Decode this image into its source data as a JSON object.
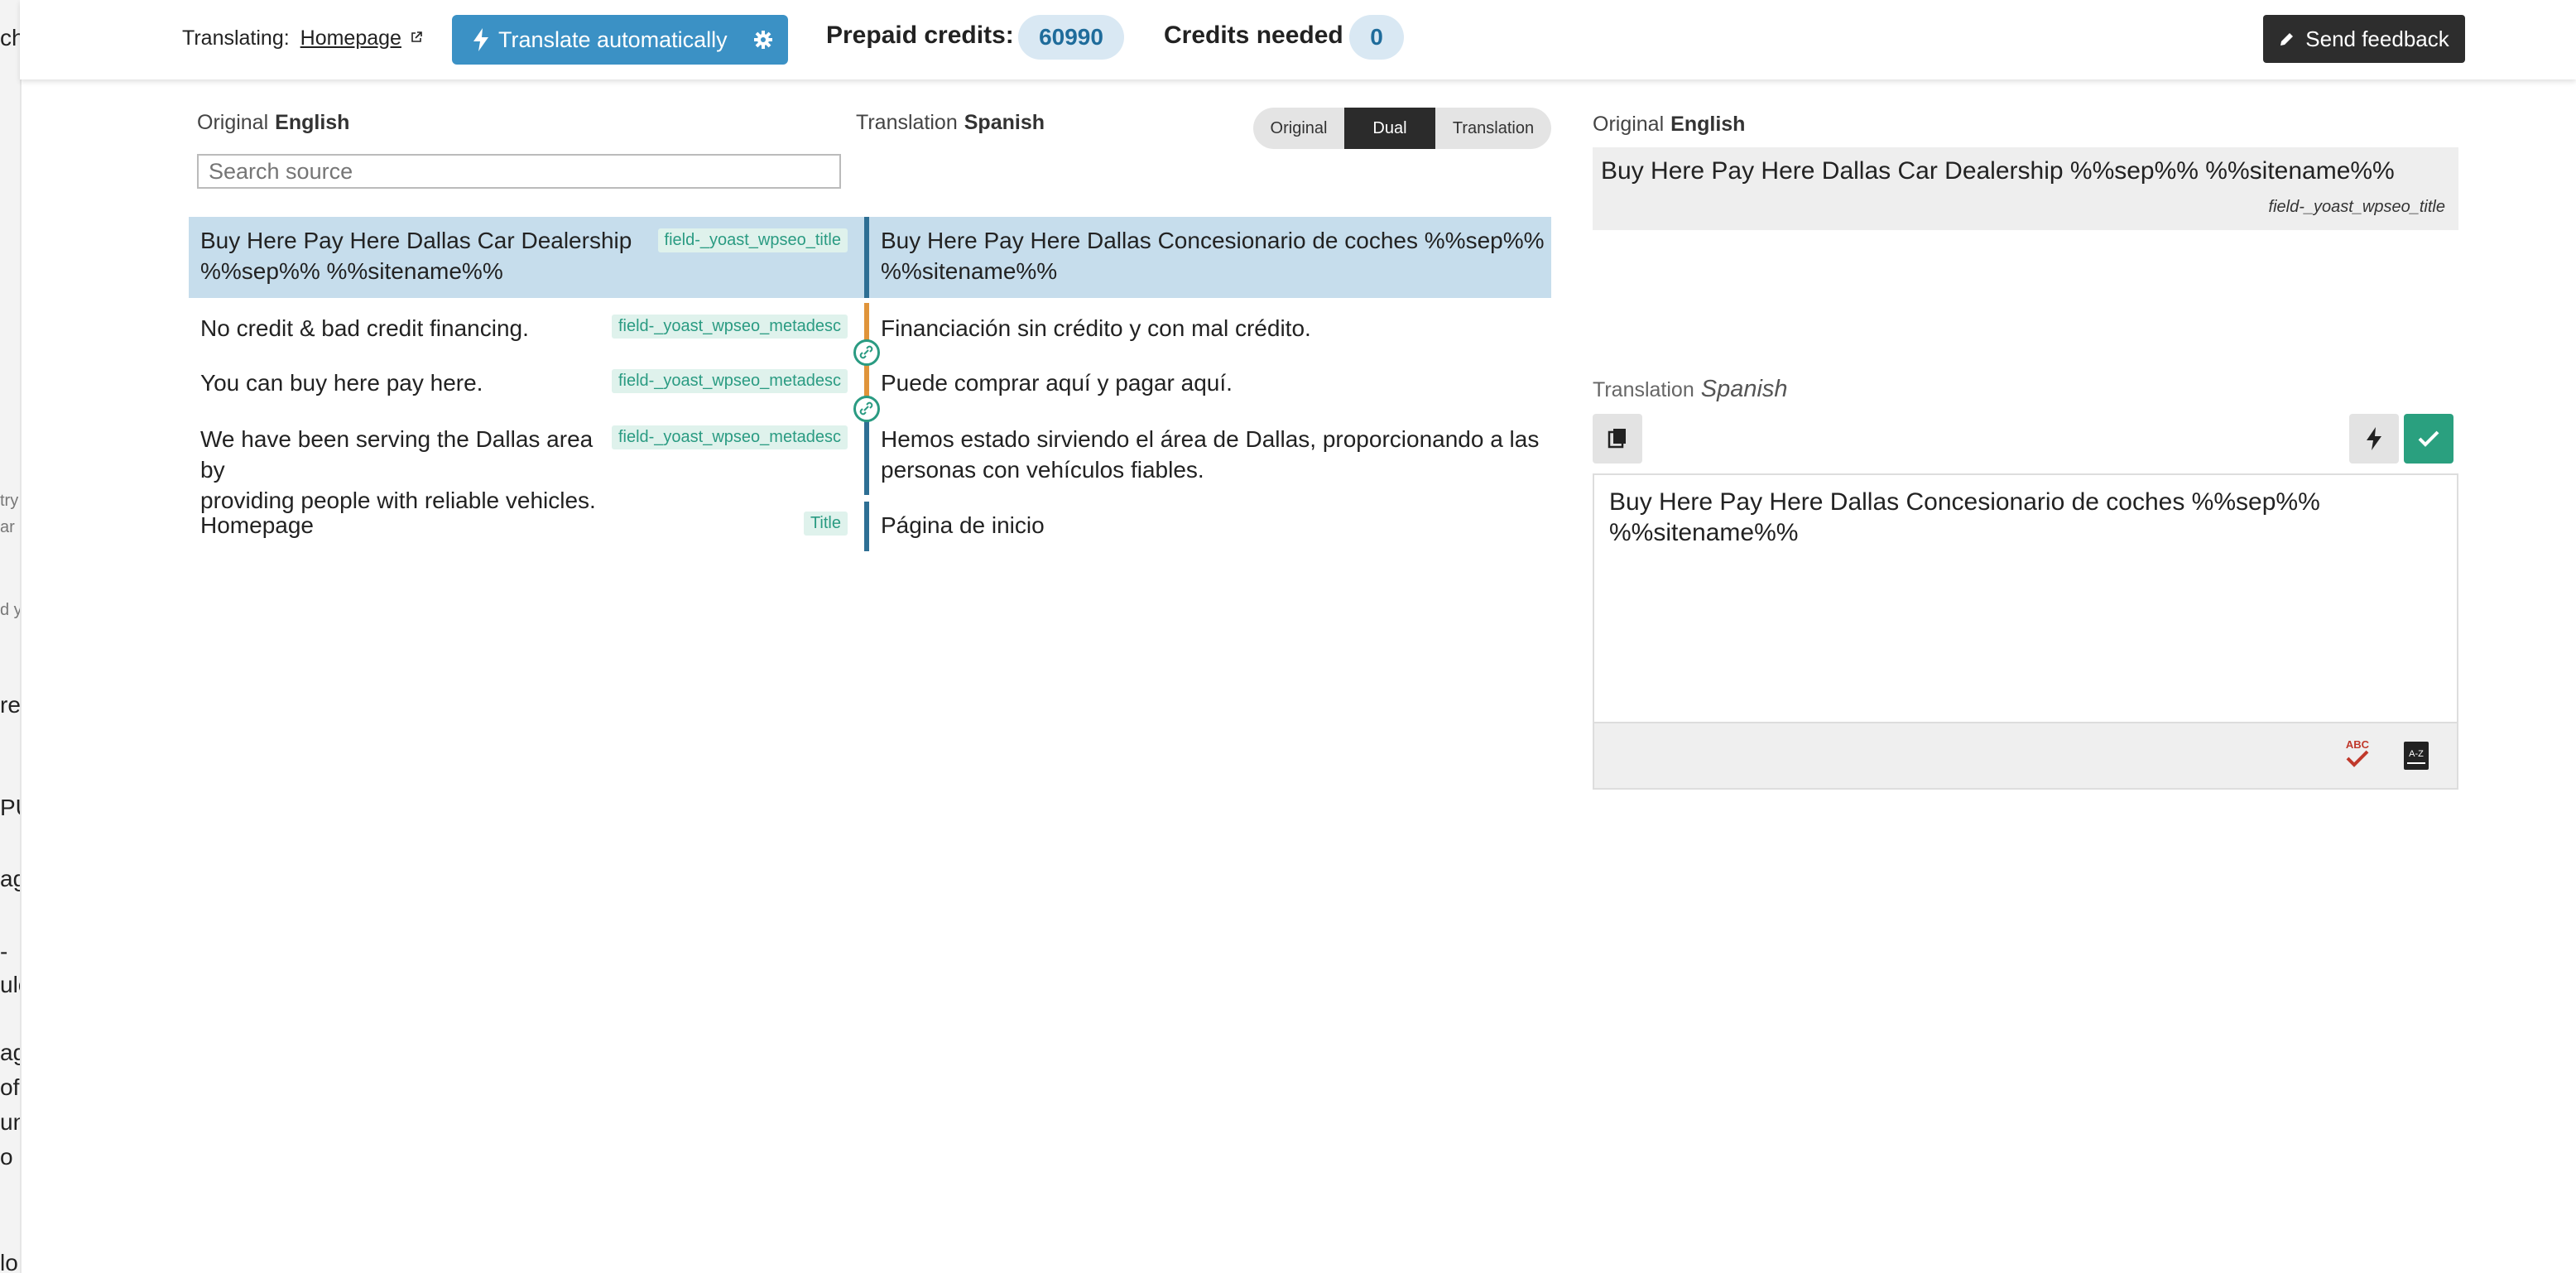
{
  "background": {
    "fragments": [
      "cha",
      "try",
      "ar",
      "d y",
      "re",
      "PU",
      "ag",
      "-",
      "ulo",
      "ag",
      "of",
      "un",
      "o",
      "lo"
    ]
  },
  "topbar": {
    "translating_label": "Translating:",
    "page_link": "Homepage",
    "translate_auto_label": "Translate automatically",
    "prepaid_label": "Prepaid credits:",
    "prepaid_value": "60990",
    "needed_label": "Credits needed",
    "needed_value": "0",
    "feedback_label": "Send feedback"
  },
  "left_column": {
    "label": "Original",
    "language": "English",
    "search_placeholder": "Search source"
  },
  "middle_column": {
    "label": "Translation",
    "language": "Spanish"
  },
  "view_toggle": {
    "options": [
      "Original",
      "Dual",
      "Translation"
    ],
    "selected": "Dual"
  },
  "rows": [
    {
      "source_line1": "Buy Here Pay Here Dallas Car Dealership",
      "source_line2": "%%sep%% %%sitename%%",
      "tag": "field-_yoast_wpseo_title",
      "translation_line1": "Buy Here Pay Here Dallas Concesionario de coches %%sep%%",
      "translation_line2": "%%sitename%%",
      "selected": true
    },
    {
      "source_line1": "No credit & bad credit financing.",
      "tag": "field-_yoast_wpseo_metadesc",
      "translation_line1": "Financiación sin crédito y con mal crédito.",
      "linked": true
    },
    {
      "source_line1": "You can buy here pay here.",
      "tag": "field-_yoast_wpseo_metadesc",
      "translation_line1": "Puede comprar aquí y pagar aquí.",
      "linked": true
    },
    {
      "source_line1": "We have been serving the Dallas area by",
      "source_line2": "providing people with reliable vehicles.",
      "tag": "field-_yoast_wpseo_metadesc",
      "translation_line1": "Hemos estado sirviendo el área de Dallas, proporcionando a las",
      "translation_line2": "personas con vehículos fiables."
    },
    {
      "source_line1": "Homepage",
      "tag": "Title",
      "translation_line1": "Página de inicio"
    }
  ],
  "editor": {
    "original_label": "Original",
    "original_language": "English",
    "original_text": "Buy Here Pay Here Dallas Car Dealership %%sep%% %%sitename%%",
    "field_name": "field-_yoast_wpseo_title",
    "translation_label": "Translation",
    "translation_language": "Spanish",
    "translation_line1": "Buy Here Pay Here Dallas Concesionario de coches %%sep%%",
    "translation_line2": "%%sitename%%",
    "spellcheck_text": "ABC",
    "glossary_text": "A-Z"
  },
  "icons": {
    "external_link": "external-link-icon",
    "bolt": "bolt-icon",
    "gear": "gear-icon",
    "pencil": "pencil-icon",
    "link": "link-icon",
    "copy": "copy-icon",
    "check": "check-icon",
    "spellcheck": "spellcheck-icon",
    "glossary": "glossary-icon"
  },
  "colors": {
    "accent_blue": "#3b91c5",
    "selected_row": "#c6ddec",
    "tag_green": "#2a9b82",
    "approve_green": "#2aa07f",
    "dark_button": "#2d2d2d",
    "link_orange": "#e0943a"
  }
}
